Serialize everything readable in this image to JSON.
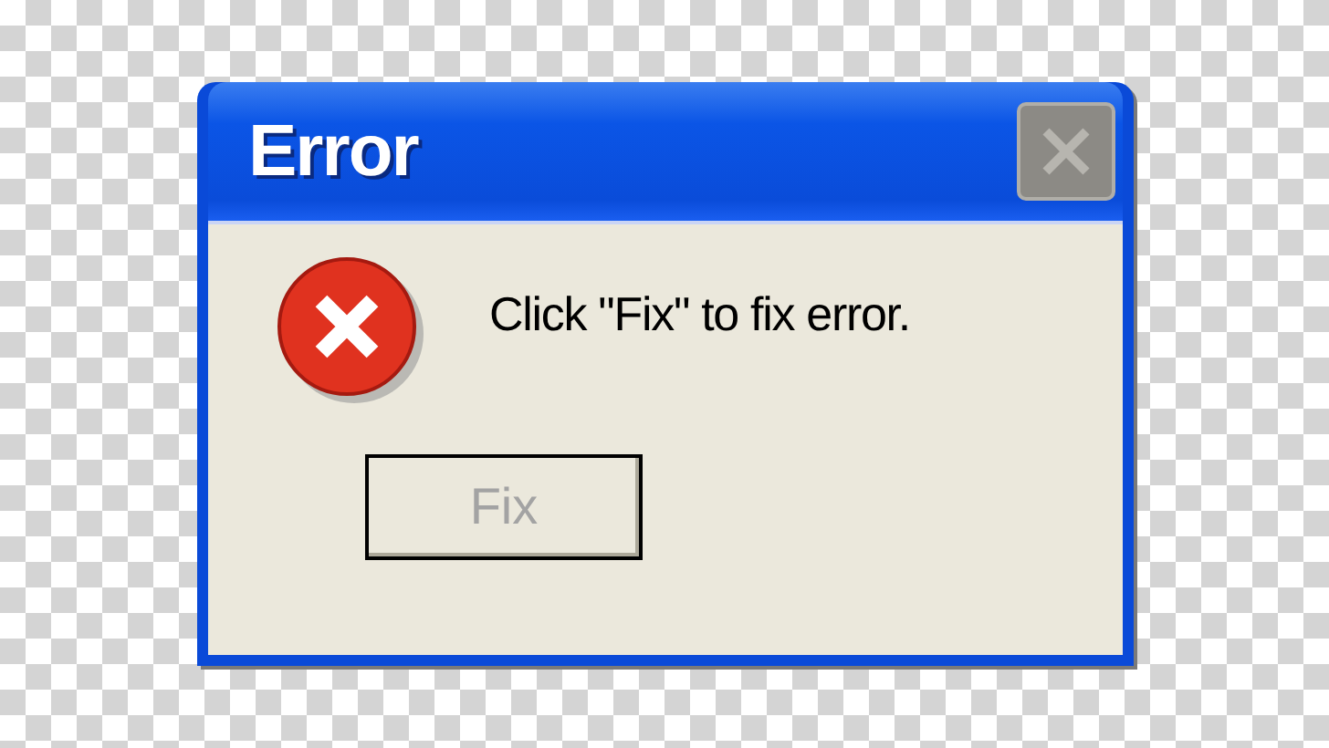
{
  "window": {
    "title": "Error",
    "close_disabled": true
  },
  "message": {
    "kind": "error",
    "text": "Click \"Fix\" to fix error."
  },
  "buttons": [
    {
      "label": "Fix",
      "disabled": true
    }
  ]
}
